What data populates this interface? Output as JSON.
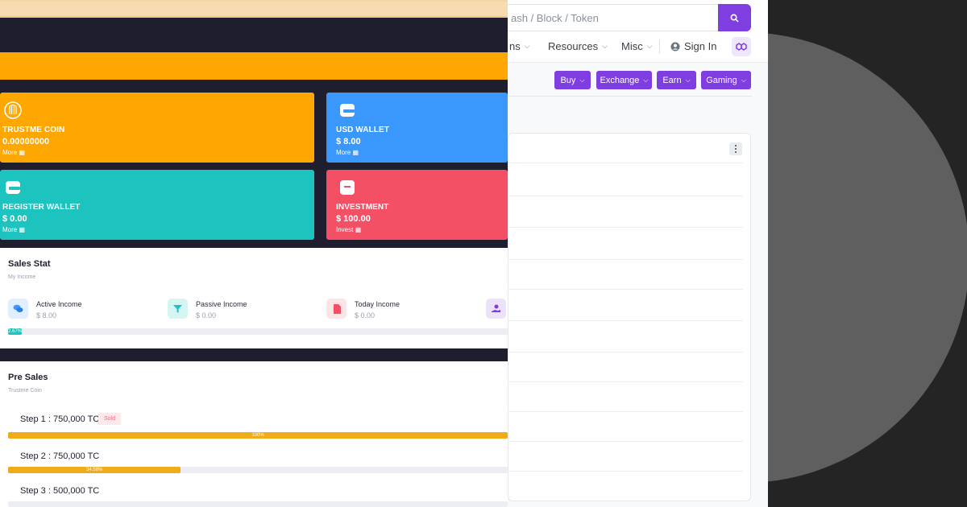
{
  "explorer": {
    "search_placeholder": "ash / Block / Token",
    "nav": [
      {
        "label": "ns"
      },
      {
        "label": "Resources"
      },
      {
        "label": "Misc"
      }
    ],
    "sign_in": "Sign In",
    "buttons": [
      {
        "label": "Buy"
      },
      {
        "label": "Exchange"
      },
      {
        "label": "Earn"
      },
      {
        "label": "Gaming"
      }
    ]
  },
  "dashboard": {
    "tiles": [
      {
        "label": "TRUSTME COIN",
        "value": "0.00000000",
        "link": "More",
        "color": "#fea700"
      },
      {
        "label": "USD WALLET",
        "value": "$ 8.00",
        "link": "More",
        "color": "#3a97fb"
      },
      {
        "label": "REGISTER WALLET",
        "value": "$ 0.00",
        "link": "More",
        "color": "#1cc3bf"
      },
      {
        "label": "INVESTMENT",
        "value": "$ 100.00",
        "link": "Invest",
        "color": "#f34f65"
      }
    ],
    "sales_stat": {
      "title": "Sales Stat",
      "subtitle": "My Income",
      "items": [
        {
          "name": "Active Income",
          "value": "$ 8.00"
        },
        {
          "name": "Passive Income",
          "value": "$ 0.00"
        },
        {
          "name": "Today Income",
          "value": "$ 0.00"
        }
      ],
      "progress_label": "2.67%",
      "progress": 0.0267
    },
    "pre_sales": {
      "title": "Pre Sales",
      "subtitle": "Trustme Coin",
      "steps": [
        {
          "label": "Step 1 : 750,000 TC",
          "badge": "Sold",
          "progress_label": "100%",
          "progress": 1.0
        },
        {
          "label": "Step 2 : 750,000 TC",
          "progress_label": "34.58%",
          "progress": 0.3458
        },
        {
          "label": "Step 3 : 500,000 TC"
        }
      ]
    }
  },
  "colors": {
    "purple": "#7f3fe0",
    "orange": "#fea700",
    "blue": "#3a97fb",
    "teal": "#1cc3bf",
    "red": "#f34f65",
    "navy": "#1f1e2e"
  }
}
